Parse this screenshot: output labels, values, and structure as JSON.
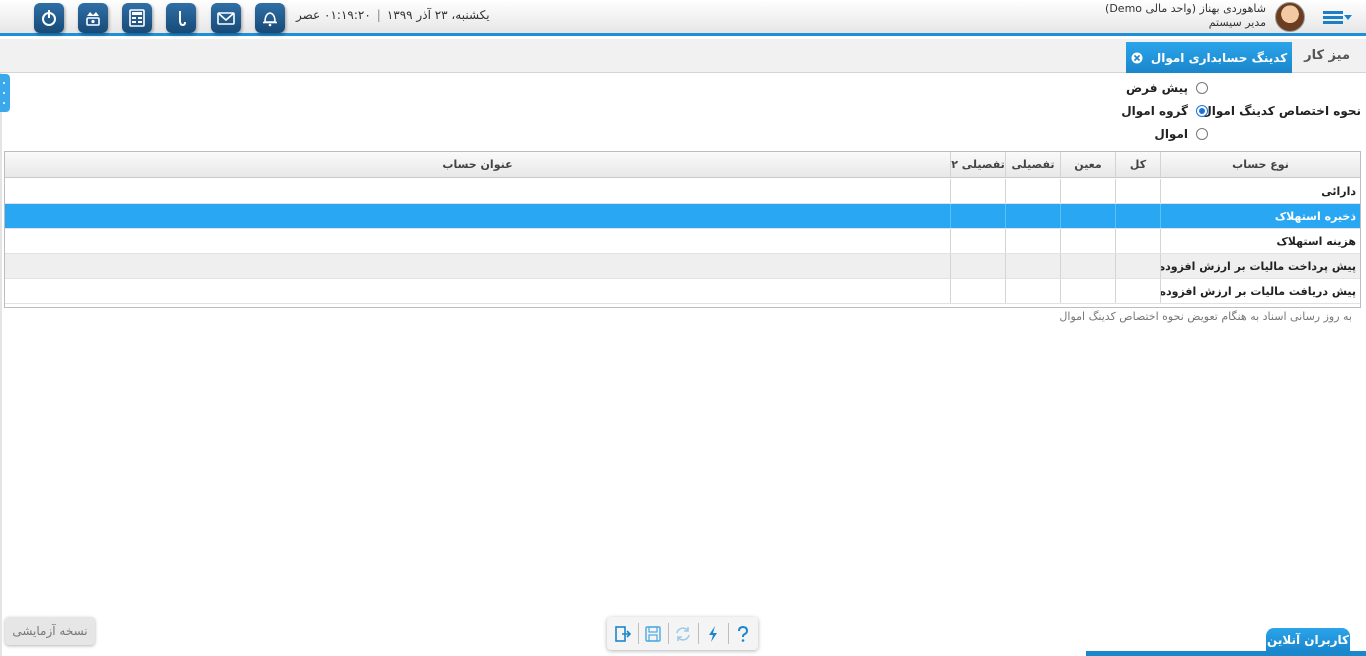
{
  "header": {
    "datetime_date": "یکشنبه، ۲۳ آذر ۱۳۹۹",
    "datetime_time": "۰۱:۱۹:۲۰ عصر",
    "user_name": "شاهوردی بهناز (واحد مالی Demo)",
    "user_role": "مدیر سیستم",
    "icons": [
      "power-icon",
      "crown-settings-icon",
      "calculator-icon",
      "question-hook-icon",
      "mail-icon",
      "bell-icon"
    ]
  },
  "tabs": {
    "home": "میز کار",
    "active": "کدینگ حسابداری اموال"
  },
  "options": {
    "label": "نحوه اختصاص کدینگ اموال",
    "items": [
      {
        "label": "پیش فرض",
        "checked": false
      },
      {
        "label": "گروه اموال",
        "checked": true
      },
      {
        "label": "اموال",
        "checked": false
      }
    ]
  },
  "grid": {
    "columns": [
      "نوع حساب",
      "کل",
      "معین",
      "تفصیلی",
      "تفصیلی ۲",
      "عنوان حساب"
    ],
    "rows": [
      {
        "type": "دارائی",
        "kol": "",
        "moein": "",
        "tafsili": "",
        "tafsili2": "",
        "title": ""
      },
      {
        "type": "ذخیره استهلاک",
        "kol": "",
        "moein": "",
        "tafsili": "",
        "tafsili2": "",
        "title": ""
      },
      {
        "type": "هزینه استهلاک",
        "kol": "",
        "moein": "",
        "tafsili": "",
        "tafsili2": "",
        "title": ""
      },
      {
        "type": "پیش پرداخت مالیات بر ارزش افزوده",
        "kol": "",
        "moein": "",
        "tafsili": "",
        "tafsili2": "",
        "title": ""
      },
      {
        "type": "پیش دریافت مالیات بر ارزش افزوده",
        "kol": "",
        "moein": "",
        "tafsili": "",
        "tafsili2": "",
        "title": ""
      }
    ],
    "selected_row": 1
  },
  "footer_note": "به روز رسانی اسناد به هنگام تعویض نحوه اختصاص کدینگ اموال",
  "bottom": {
    "trial": "نسخه آزمایشی",
    "online_users": "کاربران آنلاین"
  },
  "colors": {
    "accent": "#1e90d8",
    "selected_row": "#29a7f3",
    "icon_bg": "#174a78"
  }
}
